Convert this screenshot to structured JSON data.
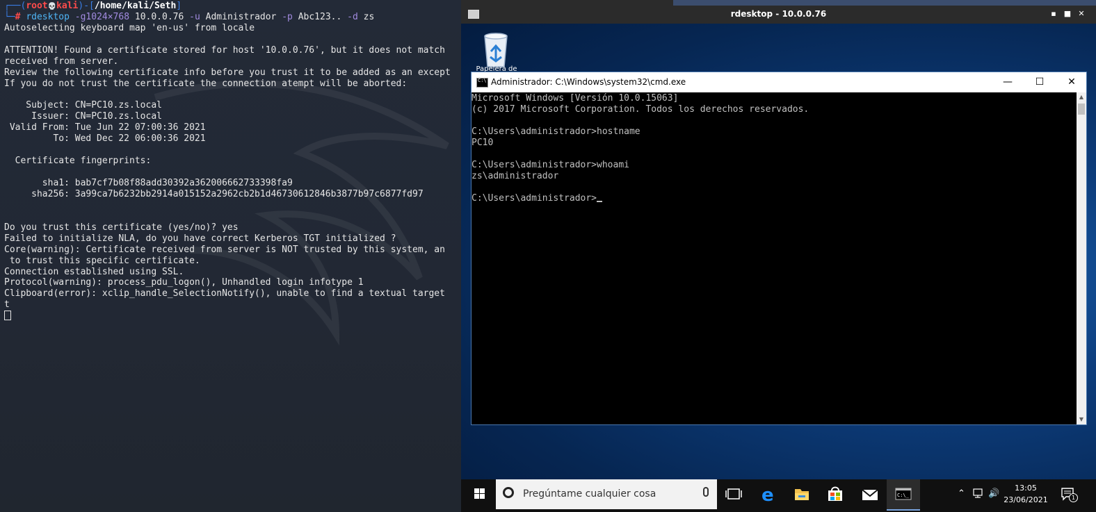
{
  "kali": {
    "prompt_frame_top": "┌──(",
    "prompt_user": "root",
    "prompt_skull": "💀",
    "prompt_host": "kali",
    "prompt_mid": ")-[",
    "prompt_path": "/home/kali/Seth",
    "prompt_end": "]",
    "prompt_frame_bottom": "└─",
    "prompt_hash": "#",
    "cmd_name": "rdesktop",
    "cmd_g_flag": "-g1024×768",
    "cmd_host": "10.0.0.76",
    "cmd_u_flag": "-u",
    "cmd_user": "Administrador",
    "cmd_p_flag": "-p",
    "cmd_pass": "Abc123..",
    "cmd_d_flag": "-d",
    "cmd_domain": "zs",
    "lines": [
      "Autoselecting keyboard map 'en-us' from locale",
      "",
      "ATTENTION! Found a certificate stored for host '10.0.0.76', but it does not match",
      "received from server.",
      "Review the following certificate info before you trust it to be added as an except",
      "If you do not trust the certificate the connection atempt will be aborted:",
      "",
      "    Subject: CN=PC10.zs.local",
      "     Issuer: CN=PC10.zs.local",
      " Valid From: Tue Jun 22 07:00:36 2021",
      "         To: Wed Dec 22 06:00:36 2021",
      "",
      "  Certificate fingerprints:",
      "",
      "       sha1: bab7cf7b08f88add30392a362006662733398fa9",
      "     sha256: 3a99ca7b6232bb2914a015152a2962cb2b1d46730612846b3877b97c6877fd97",
      "",
      "",
      "Do you trust this certificate (yes/no)? yes",
      "Failed to initialize NLA, do you have correct Kerberos TGT initialized ?",
      "Core(warning): Certificate received from server is NOT trusted by this system, an",
      " to trust this specific certificate.",
      "Connection established using SSL.",
      "Protocol(warning): process_pdu_logon(), Unhandled login infotype 1",
      "Clipboard(error): xclip_handle_SelectionNotify(), unable to find a textual target",
      "t"
    ]
  },
  "rdesktop": {
    "title": "rdesktop - 10.0.0.76",
    "minimize": "▪",
    "maximize": "■",
    "close": "✕"
  },
  "desktop": {
    "recycle_label": "Papelera de"
  },
  "cmd": {
    "title": "Administrador: C:\\Windows\\system32\\cmd.exe",
    "minimize": "—",
    "maximize": "☐",
    "close": "✕",
    "lines": [
      "Microsoft Windows [Versión 10.0.15063]",
      "(c) 2017 Microsoft Corporation. Todos los derechos reservados.",
      "",
      "C:\\Users\\administrador>hostname",
      "PC10",
      "",
      "C:\\Users\\administrador>whoami",
      "zs\\administrador",
      "",
      "C:\\Users\\administrador>"
    ]
  },
  "taskbar": {
    "search_placeholder": "Pregúntame cualquier cosa",
    "time": "13:05",
    "date": "23/06/2021",
    "notification_count": "1"
  },
  "colors": {
    "kali_bg": "#232a36",
    "prompt_blue": "#3a7ee6",
    "prompt_red": "#ff4b4b",
    "flag_purple": "#a28be0",
    "cmd_text": "#c0c0c0",
    "taskbar": "#101010"
  }
}
